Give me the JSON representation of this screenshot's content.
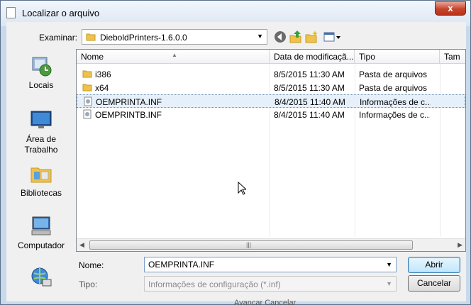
{
  "window": {
    "title": "Localizar o arquivo",
    "close_label": "x"
  },
  "toolbar": {
    "look_in_label": "Examinar:",
    "current_folder": "DieboldPrinters-1.6.0.0"
  },
  "places": [
    {
      "label": "Locais",
      "icon": "recent-places-icon"
    },
    {
      "label": "Área de\nTrabalho",
      "icon": "desktop-icon"
    },
    {
      "label": "Bibliotecas",
      "icon": "libraries-icon"
    },
    {
      "label": "Computador",
      "icon": "computer-icon"
    },
    {
      "label": "",
      "icon": "network-icon"
    }
  ],
  "columns": [
    "Nome",
    "Data de modificaçã...",
    "Tipo",
    "Tam"
  ],
  "files": [
    {
      "name": "i386",
      "date": "8/5/2015 11:30 AM",
      "type": "Pasta de arquivos",
      "icon": "folder-icon",
      "selected": false
    },
    {
      "name": "x64",
      "date": "8/5/2015 11:30 AM",
      "type": "Pasta de arquivos",
      "icon": "folder-icon",
      "selected": false
    },
    {
      "name": "OEMPRINTA.INF",
      "date": "8/4/2015 11:40 AM",
      "type": "Informações de c...",
      "icon": "inf-file-icon",
      "selected": true
    },
    {
      "name": "OEMPRINTB.INF",
      "date": "8/4/2015 11:40 AM",
      "type": "Informações de c...",
      "icon": "inf-file-icon",
      "selected": false
    }
  ],
  "filename": {
    "label": "Nome:",
    "value": "OEMPRINTA.INF"
  },
  "filetype": {
    "label": "Tipo:",
    "value": "Informações de configuração (*.inf)"
  },
  "buttons": {
    "open": "Abrir",
    "cancel": "Cancelar"
  },
  "background_text": "Avançar   Cancelar"
}
